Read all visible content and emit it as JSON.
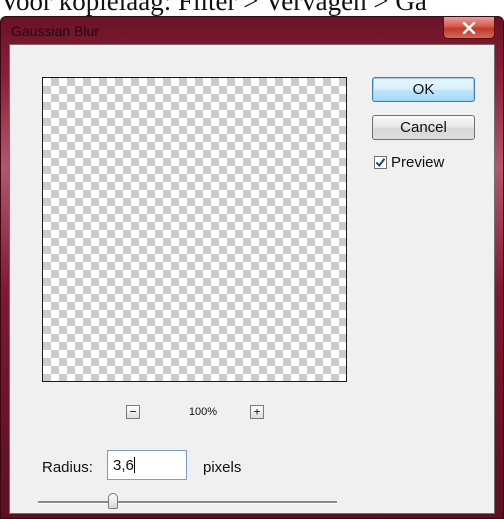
{
  "background": {
    "caption": "Voor kopielaag: Filter > Vervagen > Ga"
  },
  "window": {
    "title": "Gaussian Blur",
    "close_icon": "close-icon",
    "frame_color": "#7d1930"
  },
  "buttons": {
    "ok_label": "OK",
    "cancel_label": "Cancel"
  },
  "preview_toggle": {
    "label": "Preview",
    "checked": true
  },
  "zoom": {
    "value": "100%",
    "minus_symbol": "−",
    "plus_symbol": "+"
  },
  "radius": {
    "label": "Radius:",
    "value": "3,6",
    "units": "pixels",
    "slider_fraction": 0.25
  }
}
